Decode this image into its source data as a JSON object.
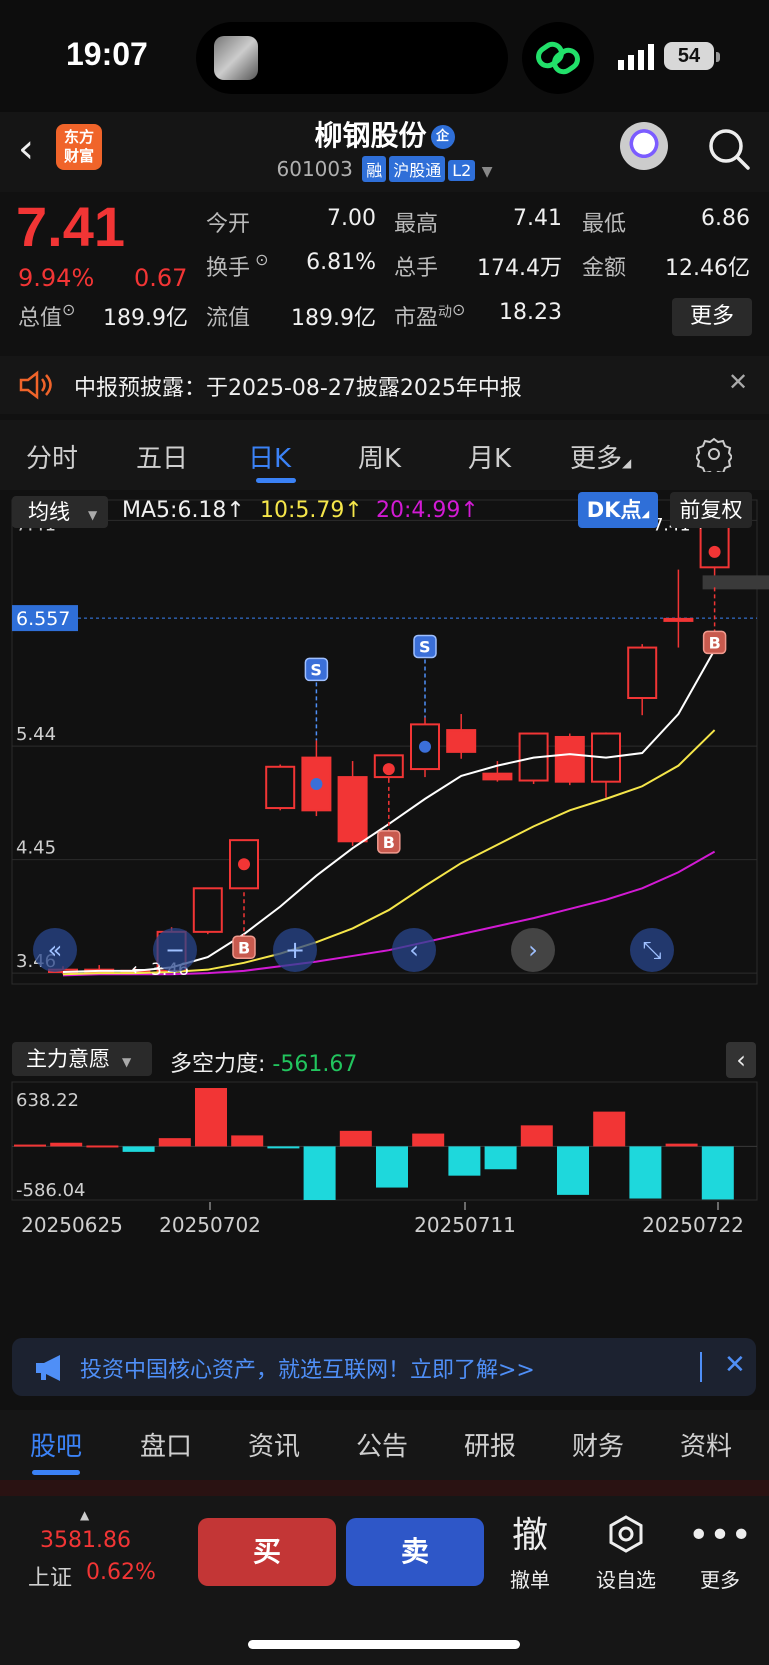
{
  "status": {
    "time": "19:07",
    "battery": "54"
  },
  "header": {
    "logo": "东方\n财富",
    "title": "柳钢股份",
    "title_badge": "企",
    "code": "601003",
    "tags": [
      "融",
      "沪股通",
      "L2"
    ]
  },
  "quote": {
    "price": "7.41",
    "pct": "9.94%",
    "change": "0.67",
    "fields": [
      {
        "label": "今开",
        "value": "7.00"
      },
      {
        "label": "最高",
        "value": "7.41"
      },
      {
        "label": "最低",
        "value": "6.86"
      },
      {
        "label": "换手",
        "value": "6.81%"
      },
      {
        "label": "总手",
        "value": "174.4万"
      },
      {
        "label": "金额",
        "value": "12.46亿"
      },
      {
        "label": "总值",
        "value": "189.9亿"
      },
      {
        "label": "流值",
        "value": "189.9亿"
      },
      {
        "label": "市盈",
        "value": "18.23"
      }
    ],
    "pe_sup": "动",
    "more": "更多"
  },
  "notice": {
    "text": "中报预披露：于2025-08-27披露2025年中报"
  },
  "period_tabs": [
    "分时",
    "五日",
    "日K",
    "周K",
    "月K",
    "更多"
  ],
  "chart_toolbar": {
    "ma_select": "均线",
    "ma5": "MA5:6.18↑",
    "ma10": "10:5.79↑",
    "ma20": "20:4.99↑",
    "dk": "DK点",
    "fq": "前复权"
  },
  "chart_data": {
    "type": "candlestick",
    "y_ticks": [
      "7.41",
      "5.44",
      "4.45",
      "3.46"
    ],
    "cursor_price": "6.557",
    "max_label": "7.41→",
    "min_label": "← 3.46",
    "ylim": [
      3.4,
      7.5
    ],
    "candles": [
      {
        "o": 3.47,
        "h": 3.52,
        "l": 3.45,
        "c": 3.49
      },
      {
        "o": 3.49,
        "h": 3.53,
        "l": 3.46,
        "c": 3.47
      },
      {
        "o": 3.47,
        "h": 3.5,
        "l": 3.45,
        "c": 3.48
      },
      {
        "o": 3.48,
        "h": 3.86,
        "l": 3.47,
        "c": 3.82
      },
      {
        "o": 3.82,
        "h": 4.2,
        "l": 3.8,
        "c": 4.2
      },
      {
        "o": 4.2,
        "h": 4.62,
        "l": 4.2,
        "c": 4.62
      },
      {
        "o": 4.9,
        "h": 5.28,
        "l": 4.88,
        "c": 5.26
      },
      {
        "o": 5.34,
        "h": 5.49,
        "l": 4.83,
        "c": 4.88
      },
      {
        "o": 5.17,
        "h": 5.31,
        "l": 4.57,
        "c": 4.61
      },
      {
        "o": 5.17,
        "h": 5.36,
        "l": 5.12,
        "c": 5.36
      },
      {
        "o": 5.24,
        "h": 5.69,
        "l": 5.17,
        "c": 5.63
      },
      {
        "o": 5.58,
        "h": 5.72,
        "l": 5.33,
        "c": 5.39
      },
      {
        "o": 5.2,
        "h": 5.31,
        "l": 5.13,
        "c": 5.15
      },
      {
        "o": 5.14,
        "h": 5.55,
        "l": 5.11,
        "c": 5.55
      },
      {
        "o": 5.52,
        "h": 5.55,
        "l": 5.1,
        "c": 5.13
      },
      {
        "o": 5.13,
        "h": 5.56,
        "l": 4.99,
        "c": 5.55
      },
      {
        "o": 5.86,
        "h": 6.33,
        "l": 5.71,
        "c": 6.3
      },
      {
        "o": 6.55,
        "h": 6.98,
        "l": 6.3,
        "c": 6.55
      },
      {
        "o": 7.0,
        "h": 7.41,
        "l": 6.86,
        "c": 7.41
      }
    ],
    "ma5": [
      3.47,
      3.48,
      3.48,
      3.51,
      3.6,
      3.8,
      4.04,
      4.31,
      4.55,
      4.76,
      4.98,
      5.18,
      5.27,
      5.34,
      5.37,
      5.34,
      5.38,
      5.72,
      6.28
    ],
    "ma10": [
      3.45,
      3.46,
      3.46,
      3.47,
      3.49,
      3.55,
      3.63,
      3.73,
      3.85,
      4.01,
      4.22,
      4.42,
      4.58,
      4.74,
      4.88,
      4.98,
      5.09,
      5.27,
      5.58
    ],
    "ma20": [
      3.44,
      3.45,
      3.45,
      3.45,
      3.46,
      3.48,
      3.52,
      3.56,
      3.61,
      3.66,
      3.73,
      3.8,
      3.87,
      3.94,
      4.02,
      4.1,
      4.2,
      4.34,
      4.52
    ],
    "signals": [
      {
        "i": 5,
        "type": "B"
      },
      {
        "i": 7,
        "type": "S"
      },
      {
        "i": 9,
        "type": "B"
      },
      {
        "i": 10,
        "type": "S"
      },
      {
        "i": 18,
        "type": "B"
      }
    ],
    "sub_chart": {
      "select": "主力意愿",
      "label": "多空力度:",
      "value": "-561.67",
      "max_label": "638.22",
      "min_label": "-586.04",
      "ylim": [
        -586.04,
        638.22
      ],
      "values": [
        20,
        40,
        10,
        -60,
        90,
        638,
        120,
        -10,
        -586,
        170,
        -450,
        140,
        -320,
        -250,
        230,
        -530,
        380,
        -570,
        30,
        -580
      ],
      "dates": [
        "20250625",
        "20250702",
        "20250711",
        "20250722"
      ]
    }
  },
  "nav_buttons": [
    "chevrons-left",
    "zoom-out",
    "zoom-in",
    "prev",
    "next",
    "expand"
  ],
  "ad": {
    "text": "投资中国核心资产，就选互联网！立即了解>>"
  },
  "bottom_tabs": [
    "股吧",
    "盘口",
    "资讯",
    "公告",
    "研报",
    "财务",
    "资料"
  ],
  "footer": {
    "index_value": "3581.86",
    "index_name": "上证",
    "index_pct": "0.62%",
    "buy": "买",
    "sell": "卖",
    "cancel_icon": "撤",
    "cancel": "撤单",
    "watch": "设自选",
    "more": "更多"
  },
  "colors": {
    "up": "#f23535",
    "down": "#1ed8dc",
    "accent": "#3b82f6",
    "ma5": "#ffffff",
    "ma10": "#f5e64a",
    "ma20": "#d21ad4"
  }
}
